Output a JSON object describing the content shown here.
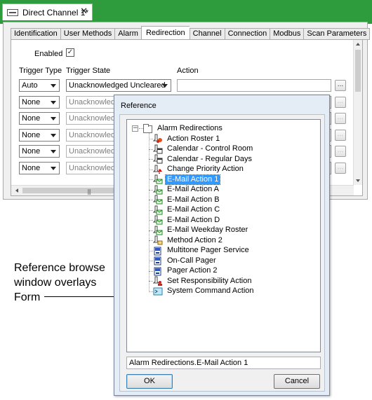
{
  "document_tab": {
    "title": "Direct Channel 1*",
    "icon": "channel-icon",
    "close_label": "✕"
  },
  "form": {
    "tabs": [
      {
        "label": "Identification",
        "active": false
      },
      {
        "label": "User Methods",
        "active": false
      },
      {
        "label": "Alarm",
        "active": false
      },
      {
        "label": "Redirection",
        "active": true
      },
      {
        "label": "Channel",
        "active": false
      },
      {
        "label": "Connection",
        "active": false
      },
      {
        "label": "Modbus",
        "active": false
      },
      {
        "label": "Scan Parameters",
        "active": false
      }
    ],
    "enabled_label": "Enabled",
    "enabled_checked": true,
    "columns": {
      "trigger_type": "Trigger Type",
      "trigger_state": "Trigger State",
      "action": "Action"
    },
    "rows": [
      {
        "type": "Auto",
        "state": "Unacknowledged Uncleared",
        "enabled": true
      },
      {
        "type": "None",
        "state": "Unacknowledged",
        "enabled": false
      },
      {
        "type": "None",
        "state": "Unacknowledged",
        "enabled": false
      },
      {
        "type": "None",
        "state": "Unacknowledged",
        "enabled": false
      },
      {
        "type": "None",
        "state": "Unacknowledged",
        "enabled": false
      },
      {
        "type": "None",
        "state": "Unacknowledged",
        "enabled": false
      }
    ],
    "browse_label": "..."
  },
  "annotation": {
    "text": "Reference browse window overlays Form"
  },
  "dialog": {
    "title": "Reference",
    "root": {
      "label": "Alarm Redirections",
      "expander": "−"
    },
    "items": [
      {
        "label": "Action Roster 1",
        "icon": "roster-icon"
      },
      {
        "label": "Calendar - Control Room",
        "icon": "calendar-icon"
      },
      {
        "label": "Calendar - Regular Days",
        "icon": "calendar-icon"
      },
      {
        "label": "Change Priority Action",
        "icon": "priority-icon"
      },
      {
        "label": "E-Mail Action 1",
        "icon": "email-icon",
        "selected": true
      },
      {
        "label": "E-Mail Action A",
        "icon": "email-icon"
      },
      {
        "label": "E-Mail Action B",
        "icon": "email-icon"
      },
      {
        "label": "E-Mail Action C",
        "icon": "email-icon"
      },
      {
        "label": "E-Mail Action D",
        "icon": "email-icon"
      },
      {
        "label": "E-Mail Weekday Roster",
        "icon": "email-icon"
      },
      {
        "label": "Method Action 2",
        "icon": "method-icon"
      },
      {
        "label": "Multitone Pager Service",
        "icon": "pager-icon"
      },
      {
        "label": "On-Call Pager",
        "icon": "pager-icon"
      },
      {
        "label": "Pager Action 2",
        "icon": "pager-icon"
      },
      {
        "label": "Set Responsibility Action",
        "icon": "responsibility-icon"
      },
      {
        "label": "System Command Action",
        "icon": "command-icon"
      }
    ],
    "path": "Alarm Redirections.E-Mail Action 1",
    "ok_label": "OK",
    "cancel_label": "Cancel"
  },
  "colors": {
    "top_bar": "#2e9c3c",
    "selection": "#3399ff",
    "dialog_frame": "#e4ecf6"
  }
}
